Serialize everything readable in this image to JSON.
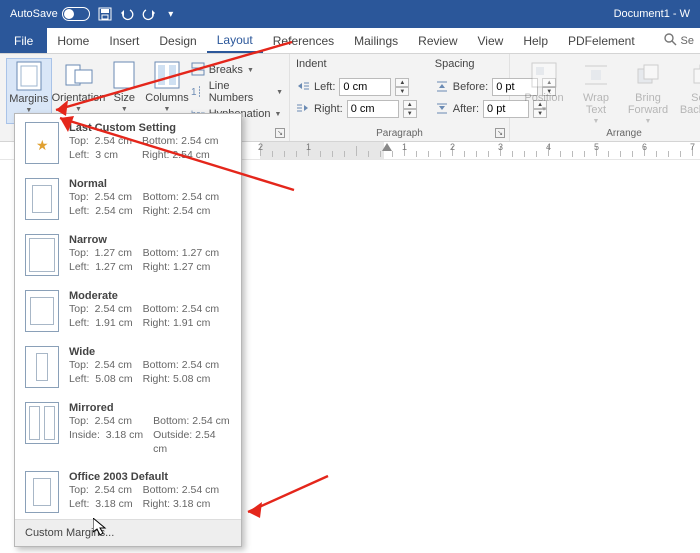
{
  "titlebar": {
    "autosave": "AutoSave",
    "doc": "Document1 - W"
  },
  "tabs": {
    "file": "File",
    "home": "Home",
    "insert": "Insert",
    "design": "Design",
    "layout": "Layout",
    "references": "References",
    "mailings": "Mailings",
    "review": "Review",
    "view": "View",
    "help": "Help",
    "pdfelement": "PDFelement",
    "search": "Se"
  },
  "ribbon": {
    "pagesetup": {
      "margins": "Margins",
      "orientation": "Orientation",
      "size": "Size",
      "columns": "Columns",
      "breaks": "Breaks",
      "linenumbers": "Line Numbers",
      "hyphenation": "Hyphenation"
    },
    "paragraph": {
      "group": "Paragraph",
      "indent": "Indent",
      "spacing": "Spacing",
      "left": "Left:",
      "right": "Right:",
      "before": "Before:",
      "after": "After:",
      "left_v": "0 cm",
      "right_v": "0 cm",
      "before_v": "0 pt",
      "after_v": "0 pt"
    },
    "arrange": {
      "group": "Arrange",
      "position": "Position",
      "wraptext": "Wrap Text",
      "bringfwd": "Bring Forward",
      "sendbwd": "Send Backward"
    }
  },
  "ruler": {
    "labels": [
      "2",
      "1",
      "",
      "1",
      "2",
      "3",
      "4",
      "5",
      "6",
      "7"
    ]
  },
  "margins_menu": {
    "items": [
      {
        "title": "Last Custom Setting",
        "a": "Top:",
        "av": "2.54 cm",
        "b": "Bottom:",
        "bv": "2.54 cm",
        "c": "Left:",
        "cv": "3 cm",
        "d": "Right:",
        "dv": "2.54 cm",
        "thumb": "star"
      },
      {
        "title": "Normal",
        "a": "Top:",
        "av": "2.54 cm",
        "b": "Bottom:",
        "bv": "2.54 cm",
        "c": "Left:",
        "cv": "2.54 cm",
        "d": "Right:",
        "dv": "2.54 cm",
        "inset": "6 6 6 6"
      },
      {
        "title": "Narrow",
        "a": "Top:",
        "av": "1.27 cm",
        "b": "Bottom:",
        "bv": "1.27 cm",
        "c": "Left:",
        "cv": "1.27 cm",
        "d": "Right:",
        "dv": "1.27 cm",
        "inset": "3 3 3 3"
      },
      {
        "title": "Moderate",
        "a": "Top:",
        "av": "2.54 cm",
        "b": "Bottom:",
        "bv": "2.54 cm",
        "c": "Left:",
        "cv": "1.91 cm",
        "d": "Right:",
        "dv": "1.91 cm",
        "inset": "6 4 6 4"
      },
      {
        "title": "Wide",
        "a": "Top:",
        "av": "2.54 cm",
        "b": "Bottom:",
        "bv": "2.54 cm",
        "c": "Left:",
        "cv": "5.08 cm",
        "d": "Right:",
        "dv": "5.08 cm",
        "inset": "6 10 6 10"
      },
      {
        "title": "Mirrored",
        "a": "Top:",
        "av": "2.54 cm",
        "b": "Bottom:",
        "bv": "2.54 cm",
        "c": "Inside:",
        "cv": "3.18 cm",
        "d": "Outside:",
        "dv": "2.54 cm",
        "mirror": true
      },
      {
        "title": "Office 2003 Default",
        "a": "Top:",
        "av": "2.54 cm",
        "b": "Bottom:",
        "bv": "2.54 cm",
        "c": "Left:",
        "cv": "3.18 cm",
        "d": "Right:",
        "dv": "3.18 cm",
        "inset": "6 7 6 7"
      }
    ],
    "custom": "Custom Margins..."
  }
}
